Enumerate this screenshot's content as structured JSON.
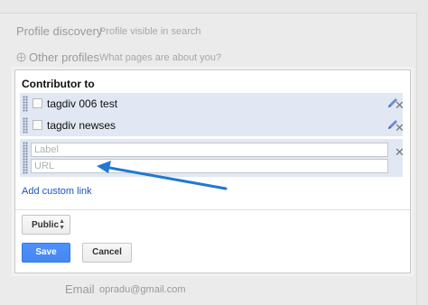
{
  "background_rows": {
    "profile_discovery": {
      "label": "Profile discovery",
      "value": "Profile visible in search"
    },
    "other_profiles": {
      "label": "Other profiles",
      "value": "What pages are about you?"
    },
    "email": {
      "label": "Email",
      "value": "opradu@gmail.com"
    }
  },
  "dialog": {
    "title": "Contributor to",
    "items": [
      {
        "label": "tagdiv 006 test"
      },
      {
        "label": "tagdiv newses"
      }
    ],
    "new_link": {
      "label_placeholder": "Label",
      "url_placeholder": "URL"
    },
    "add_custom_link": "Add custom link",
    "visibility": "Public",
    "save_label": "Save",
    "cancel_label": "Cancel"
  },
  "colors": {
    "accent": "#4d90fe",
    "link": "#1a55c8",
    "annotation_arrow": "#1f78d1",
    "item_bg": "#e1e7f3"
  }
}
